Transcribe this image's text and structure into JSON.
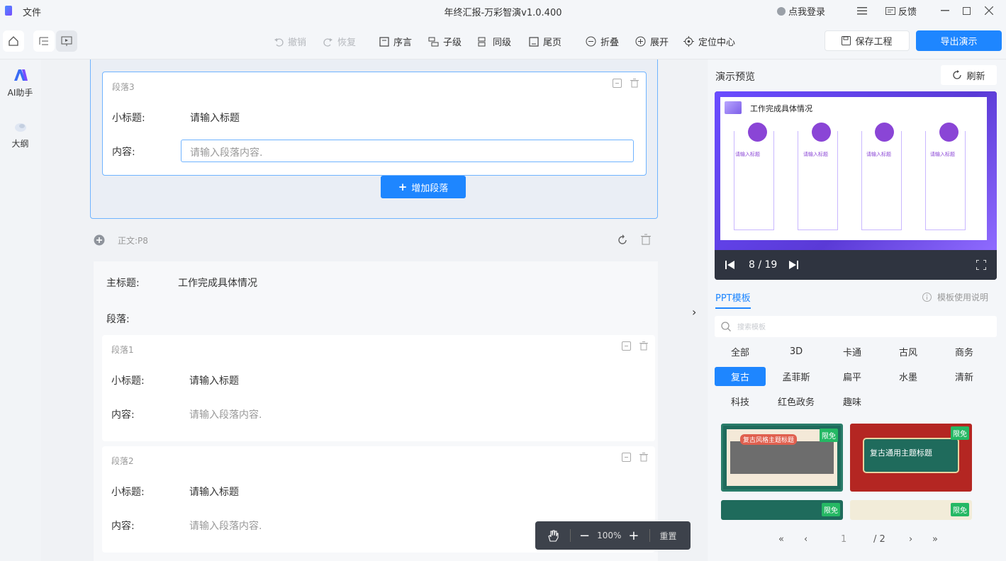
{
  "titlebar": {
    "file_menu": "文件",
    "title": "年终汇报-万彩智演v1.0.400",
    "login": "点我登录",
    "feedback": "反馈"
  },
  "toolbar": {
    "undo": "撤销",
    "redo": "恢复",
    "preface": "序言",
    "child": "子级",
    "sibling": "同级",
    "ending": "尾页",
    "collapse": "折叠",
    "expand": "展开",
    "locate_center": "定位中心",
    "save_project": "保存工程",
    "export_demo": "导出演示"
  },
  "leftnav": {
    "ai_assistant": "AI助手",
    "outline": "大纲"
  },
  "editor": {
    "para3": {
      "label": "段落3",
      "subtitle_label": "小标题:",
      "subtitle_value": "请输入标题",
      "content_label": "内容:",
      "content_placeholder": "请输入段落内容."
    },
    "add_paragraph": "增加段落",
    "section": {
      "label": "正文:P8",
      "main_title_label": "主标题:",
      "main_title_value": "工作完成具体情况",
      "paragraphs_label": "段落:"
    },
    "paragraphs": [
      {
        "label": "段落1",
        "subtitle_label": "小标题:",
        "subtitle_value": "请输入标题",
        "content_label": "内容:",
        "content_placeholder": "请输入段落内容."
      },
      {
        "label": "段落2",
        "subtitle_label": "小标题:",
        "subtitle_value": "请输入标题",
        "content_label": "内容:",
        "content_placeholder": "请输入段落内容."
      }
    ],
    "zoom": {
      "value": "100%",
      "reset": "重置"
    }
  },
  "preview": {
    "title": "演示预览",
    "refresh": "刷新",
    "slide_title": "工作完成具体情况",
    "slide_items": [
      "请输入标题",
      "请输入标题",
      "请输入标题",
      "请输入标题"
    ],
    "page_indicator": "8 / 19"
  },
  "templates": {
    "tab": "PPT模板",
    "help": "模板使用说明",
    "search_placeholder": "搜索模板",
    "categories": [
      "全部",
      "3D",
      "卡通",
      "古风",
      "商务",
      "复古",
      "孟菲斯",
      "扁平",
      "水墨",
      "清新",
      "科技",
      "红色政务",
      "趣味"
    ],
    "selected_category": "复古",
    "cards": [
      {
        "badge": "限免",
        "text": "复古风格主题标题"
      },
      {
        "badge": "限免",
        "text": "复古通用主题标题"
      },
      {
        "badge": "限免"
      },
      {
        "badge": "限免"
      }
    ],
    "pager": {
      "current": "1",
      "total": "/ 2"
    }
  },
  "colors": {
    "accent": "#1e86ff",
    "badge": "#25b864",
    "slide_purple": "#6a4cff"
  }
}
